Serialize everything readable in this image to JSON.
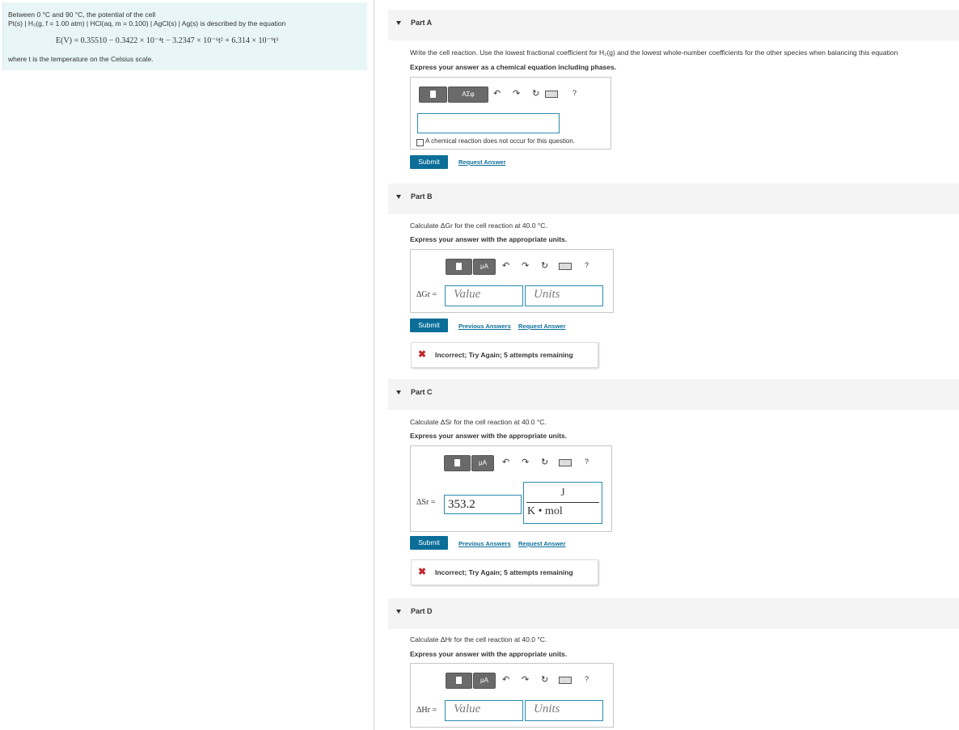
{
  "intro": {
    "line1": "Between 0 °C and 90 °C, the potential of the cell",
    "line2": "Pt(s) | H₂(g, f = 1.00 atm) | HCl(aq, m = 0.100) | AgCl(s) | Ag(s) is described by the equation",
    "equation": "E(V) = 0.35510 − 0.3422 × 10⁻⁴t − 3.2347 × 10⁻⁶t² + 6.314 × 10⁻⁹t³",
    "line3": "where t is the temperature on the Celsius scale."
  },
  "partA": {
    "label": "Part A",
    "instruction": "Write the cell reaction. Use the lowest fractional coefficient for H₂(g) and the lowest whole-number coefficients for the other species when balancing this equation",
    "express": "Express your answer as a chemical equation including phases.",
    "toolbar_btn2": "AΣφ",
    "help": "?",
    "checkbox_label": "A chemical reaction does not occur for this question.",
    "submit": "Submit",
    "request": "Request Answer"
  },
  "partB": {
    "label": "Part B",
    "question": "Calculate ΔGr for the cell reaction at 40.0 °C.",
    "express": "Express your answer with the appropriate units.",
    "toolbar_btn2": "μA",
    "help": "?",
    "eq_label": "ΔGr =",
    "value_placeholder": "Value",
    "units_placeholder": "Units",
    "submit": "Submit",
    "prev": "Previous Answers",
    "request": "Request Answer",
    "feedback": "Incorrect; Try Again; 5 attempts remaining"
  },
  "partC": {
    "label": "Part C",
    "question": "Calculate ΔSr for the cell reaction at 40.0 °C.",
    "express": "Express your answer with the appropriate units.",
    "toolbar_btn2": "μA",
    "help": "?",
    "eq_label": "ΔSr =",
    "value": "353.2",
    "unit_num": "J",
    "unit_den": "K • mol",
    "submit": "Submit",
    "prev": "Previous Answers",
    "request": "Request Answer",
    "feedback": "Incorrect; Try Again; 5 attempts remaining"
  },
  "partD": {
    "label": "Part D",
    "question": "Calculate ΔHr for the cell reaction at 40.0 °C.",
    "express": "Express your answer with the appropriate units.",
    "toolbar_btn2": "μA",
    "help": "?",
    "eq_label": "ΔHr =",
    "value_placeholder": "Value",
    "units_placeholder": "Units"
  }
}
